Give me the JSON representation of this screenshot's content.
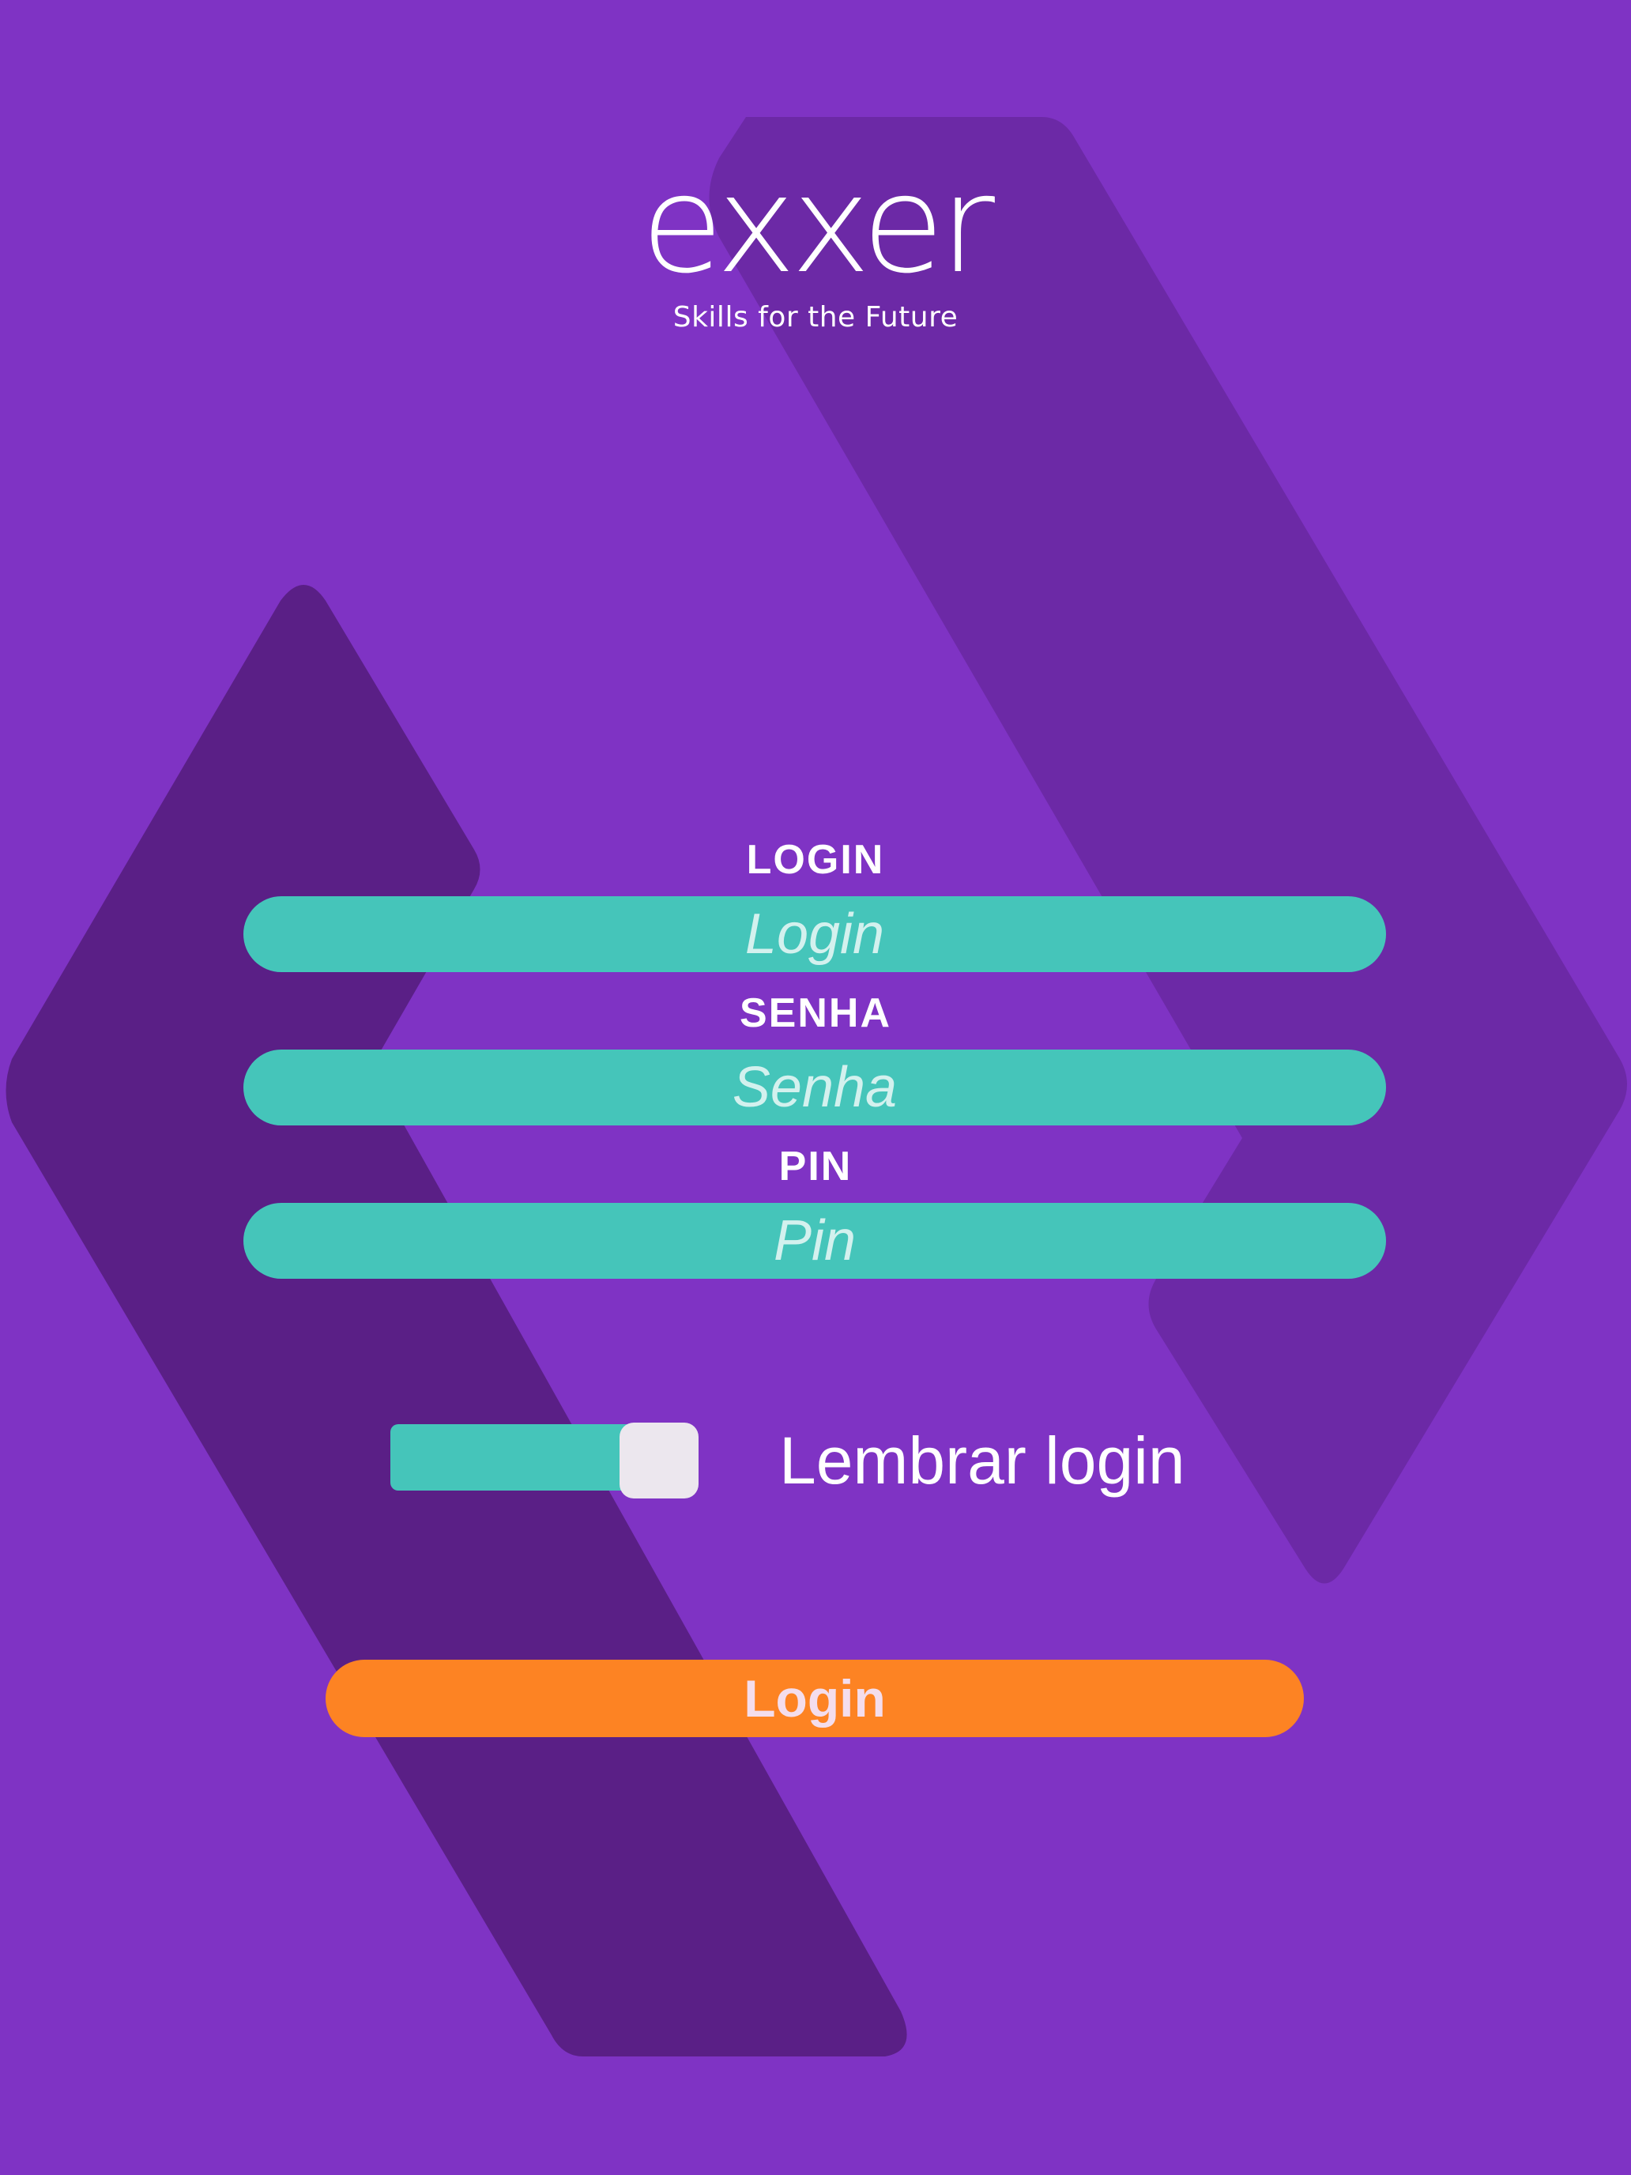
{
  "brand": {
    "logo_text": "exxer",
    "tagline": "Skills for the Future"
  },
  "form": {
    "login_label": "LOGIN",
    "login_placeholder": "Login",
    "password_label": "SENHA",
    "password_placeholder": "Senha",
    "pin_label": "PIN",
    "pin_placeholder": "Pin"
  },
  "remember": {
    "label": "Lembrar login",
    "checked": true
  },
  "submit": {
    "label": "Login"
  },
  "colors": {
    "background": "#7f33c4",
    "input_fill": "#45c5ba",
    "button_fill": "#fd8323",
    "shape_dark": "#5a1f86",
    "shape_mid": "#6c29a6"
  }
}
